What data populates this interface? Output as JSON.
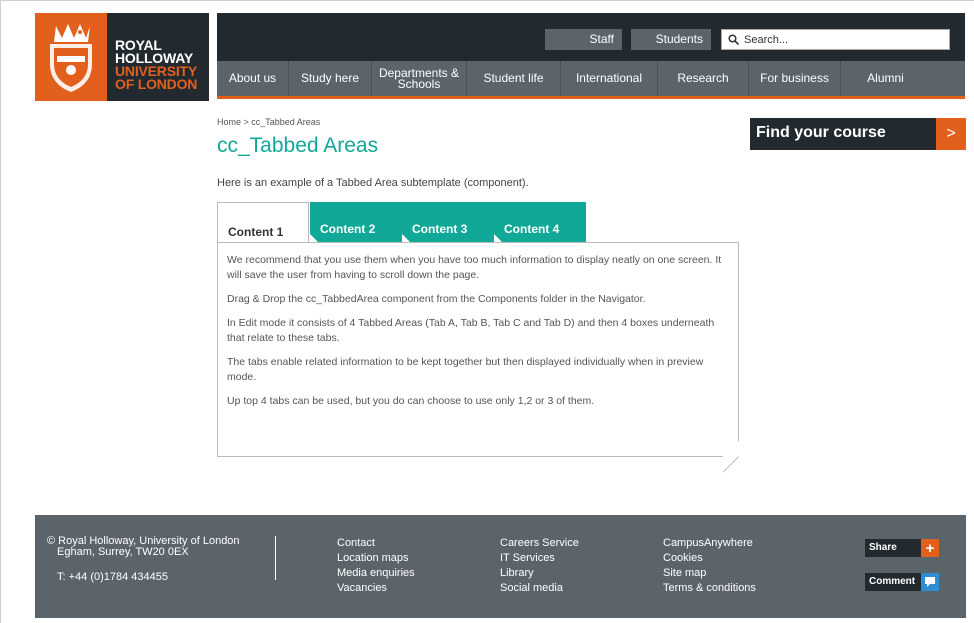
{
  "brand": {
    "line1": "ROYAL",
    "line2": "HOLLOWAY",
    "line3": "UNIVERSITY",
    "line4": "OF LONDON",
    "orange": "#e3601c",
    "dark": "#222a30",
    "teal": "#12a898"
  },
  "header": {
    "staff": "Staff",
    "students": "Students",
    "search_placeholder": "Search..."
  },
  "nav": [
    "About us",
    "Study here",
    "Departments & Schools",
    "Student life",
    "International",
    "Research",
    "For business",
    "Alumni"
  ],
  "breadcrumb": "Home > cc_Tabbed Areas",
  "page_title": "cc_Tabbed Areas",
  "intro": "Here is an example of a Tabbed Area subtemplate (component).",
  "find_course": {
    "label": "Find your course",
    "arrow": ">"
  },
  "tabs": [
    "Content 1",
    "Content 2",
    "Content 3",
    "Content 4"
  ],
  "panel": {
    "paragraphs": [
      "We recommend that you use them when you have too much information to display neatly on one screen.  It will save the user from having to scroll down the page.",
      "Drag & Drop the cc_TabbedArea component from the Components folder in the Navigator.",
      "In Edit mode it consists of 4 Tabbed Areas (Tab A, Tab B, Tab C and Tab D) and then 4 boxes underneath that relate to these tabs.",
      "The tabs enable related information to be kept together but then displayed individually when in preview mode.",
      "Up top 4 tabs can be used, but you do can choose to use only 1,2 or 3 of them."
    ]
  },
  "footer": {
    "address_line1": "© Royal Holloway, University of London",
    "address_line2": "Egham, Surrey, TW20 0EX",
    "phone": "T: +44 (0)1784 434455",
    "col1": [
      "Contact",
      "Location maps",
      "Media enquiries",
      "Vacancies"
    ],
    "col2": [
      "Careers Service",
      "IT Services",
      "Library",
      "Social media"
    ],
    "col3": [
      "CampusAnywhere",
      "Cookies",
      "Site map",
      "Terms & conditions"
    ],
    "share": "Share",
    "comment": "Comment"
  }
}
